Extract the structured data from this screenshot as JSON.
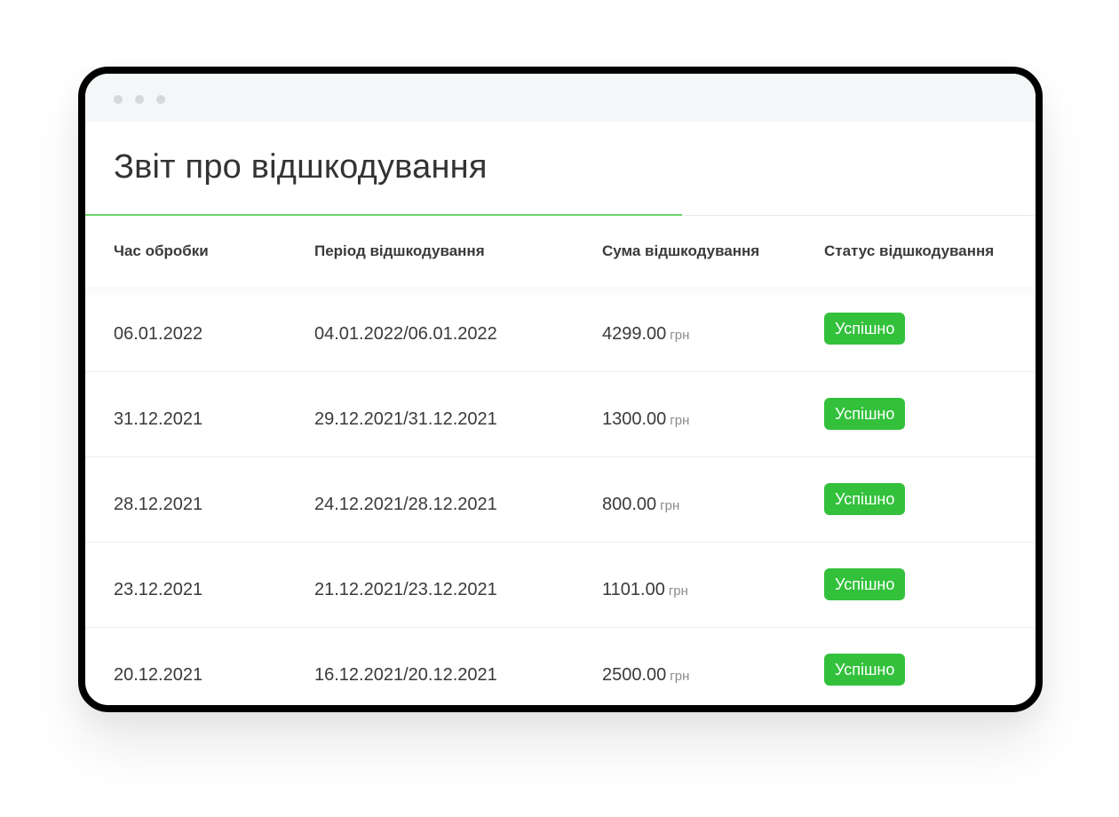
{
  "page": {
    "title": "Звіт про відшкодування"
  },
  "table": {
    "headers": {
      "processing_time": "Час обробки",
      "period": "Період відшкодування",
      "amount": "Сума відшкодування",
      "status": "Статус відшкодування"
    },
    "rows": [
      {
        "processing_time": "06.01.2022",
        "period": "04.01.2022/06.01.2022",
        "amount": "4299.00",
        "unit": "грн",
        "status": "Успішно"
      },
      {
        "processing_time": "31.12.2021",
        "period": "29.12.2021/31.12.2021",
        "amount": "1300.00",
        "unit": "грн",
        "status": "Успішно"
      },
      {
        "processing_time": "28.12.2021",
        "period": "24.12.2021/28.12.2021",
        "amount": "800.00",
        "unit": "грн",
        "status": "Успішно"
      },
      {
        "processing_time": "23.12.2021",
        "period": "21.12.2021/23.12.2021",
        "amount": "1101.00",
        "unit": "грн",
        "status": "Успішно"
      },
      {
        "processing_time": "20.12.2021",
        "period": "16.12.2021/20.12.2021",
        "amount": "2500.00",
        "unit": "грн",
        "status": "Успішно"
      }
    ]
  },
  "colors": {
    "accent_green": "#33c13c",
    "progress_green": "#6cd36c",
    "text": "#3a3a3a",
    "titlebar": "#f4f7f8"
  }
}
